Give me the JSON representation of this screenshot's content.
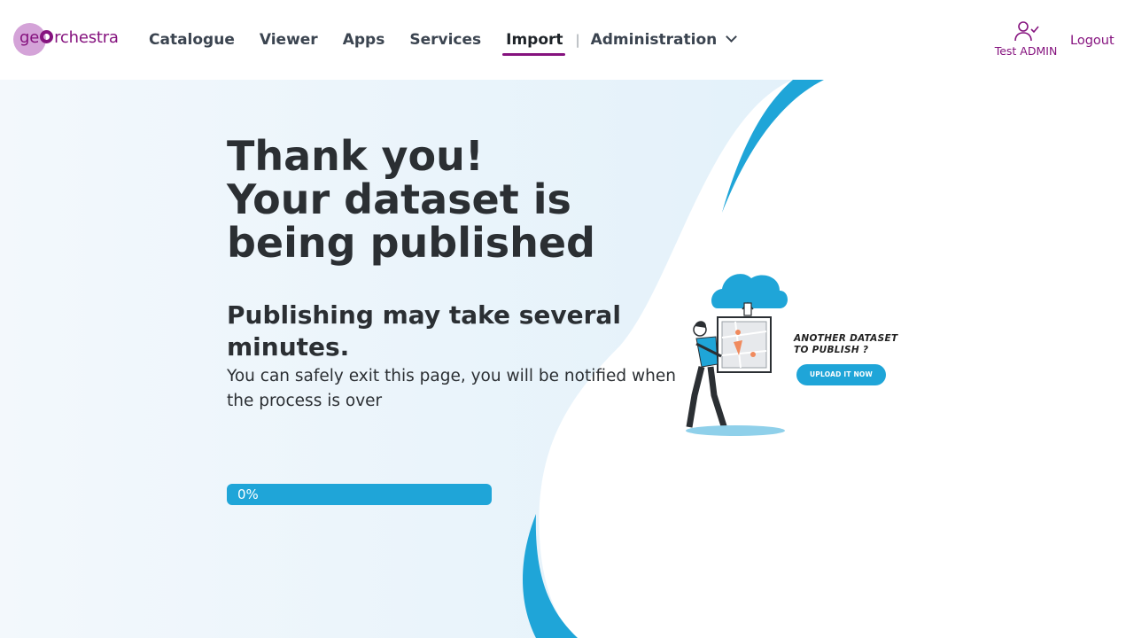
{
  "header": {
    "logo": {
      "prefix": "ge",
      "suffix": "rchestra"
    },
    "nav": [
      {
        "label": "Catalogue"
      },
      {
        "label": "Viewer"
      },
      {
        "label": "Apps"
      },
      {
        "label": "Services"
      },
      {
        "label": "Import",
        "active": true
      },
      {
        "label": "Administration"
      }
    ],
    "separator": "|",
    "user": {
      "name": "Test ADMIN",
      "icon": "user-check-icon"
    },
    "logout": "Logout"
  },
  "main": {
    "title_line1": "Thank you!",
    "title_line2": "Your dataset is being published",
    "subtitle": "Publishing may take several minutes.",
    "description": "You can safely exit this page, you will be notified when the process is over",
    "progress": {
      "value": 0,
      "label": "0%"
    },
    "illustration": {
      "caption_line1": "Another dataset",
      "caption_line2": "to publish ?",
      "button": "UPLOAD IT NOW"
    }
  },
  "colors": {
    "brand": "#85127e",
    "accent": "#1fa5d8",
    "text": "#2b2f33"
  }
}
